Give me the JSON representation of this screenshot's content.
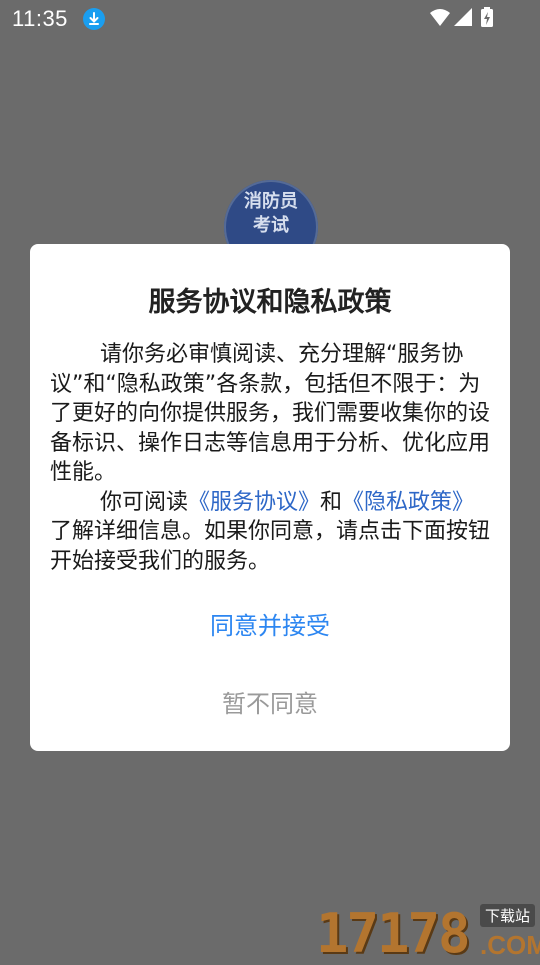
{
  "status_bar": {
    "time": "11:35",
    "icons": [
      "download-icon",
      "wifi-icon",
      "signal-icon",
      "battery-charging-icon"
    ]
  },
  "app_logo": {
    "line1": "消防员",
    "line2": "考试"
  },
  "dialog": {
    "title": "服务协议和隐私政策",
    "para1": "请你务必审慎阅读、充分理解“服务协议”和“隐私政策”各条款，包括但不限于：为了更好的向你提供服务，我们需要收集你的设备标识、操作日志等信息用于分析、优化应用性能。",
    "para2_pre": "你可阅读",
    "link_service": "《服务协议》",
    "para2_and": "和",
    "link_privacy": "《隐私政策》",
    "para2_post": "了解详细信息。如果你同意，请点击下面按钮开始接受我们的服务。",
    "agree_label": "同意并接受",
    "decline_label": "暂不同意"
  },
  "watermark": {
    "number": "17178",
    "tag": "下载站",
    "domain": ".COM"
  },
  "colors": {
    "overlay": "#6b6b6b",
    "link": "#2d67c7",
    "agree": "#2c86f1",
    "decline": "#9a9a9a"
  }
}
